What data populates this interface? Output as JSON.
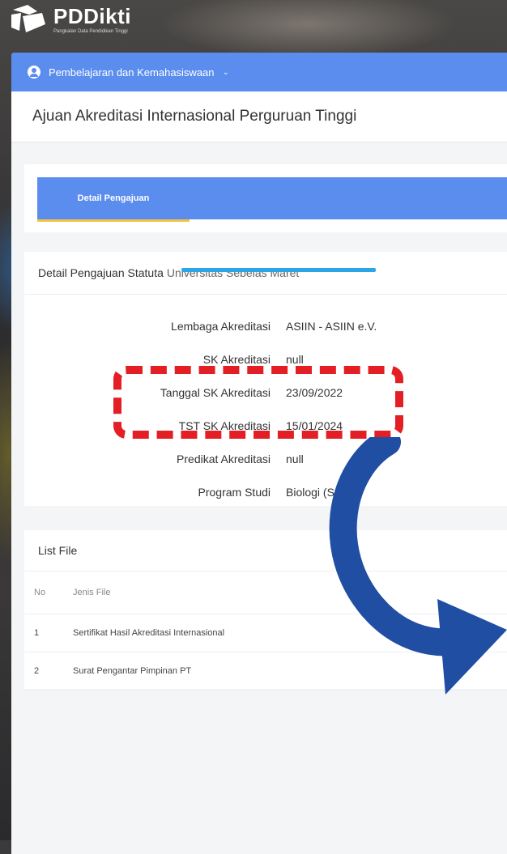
{
  "brand": {
    "name": "PDDikti",
    "tagline": "Pangkalan Data Pendidikan Tinggi"
  },
  "topbar": {
    "menu_label": "Pembelajaran dan Kemahasiswaan"
  },
  "page": {
    "title": "Ajuan Akreditasi Internasional Perguruan Tinggi"
  },
  "tabs": [
    {
      "label": "Detail Pengajuan"
    }
  ],
  "detail": {
    "heading": "Detail Pengajuan Statuta",
    "university": "Universitas Sebelas Maret",
    "rows": [
      {
        "label": "Lembaga Akreditasi",
        "value": "ASIIN - ASIIN e.V."
      },
      {
        "label": "SK Akreditasi",
        "value": "null"
      },
      {
        "label": "Tanggal SK Akreditasi",
        "value": "23/09/2022"
      },
      {
        "label": "TST SK Akreditasi",
        "value": "15/01/2024"
      },
      {
        "label": "Predikat Akreditasi",
        "value": "null"
      },
      {
        "label": "Program Studi",
        "value": "Biologi (S1)"
      }
    ]
  },
  "list_file": {
    "heading": "List File",
    "columns": [
      "No",
      "Jenis File"
    ],
    "rows": [
      {
        "no": "1",
        "jenis": "Sertifikat Hasil Akreditasi Internasional"
      },
      {
        "no": "2",
        "jenis": "Surat Pengantar Pimpinan PT"
      }
    ]
  },
  "colors": {
    "primary": "#5b8def",
    "accent": "#f5c342",
    "annotation_red": "#e31e24",
    "annotation_arrow": "#1f4ea3"
  }
}
